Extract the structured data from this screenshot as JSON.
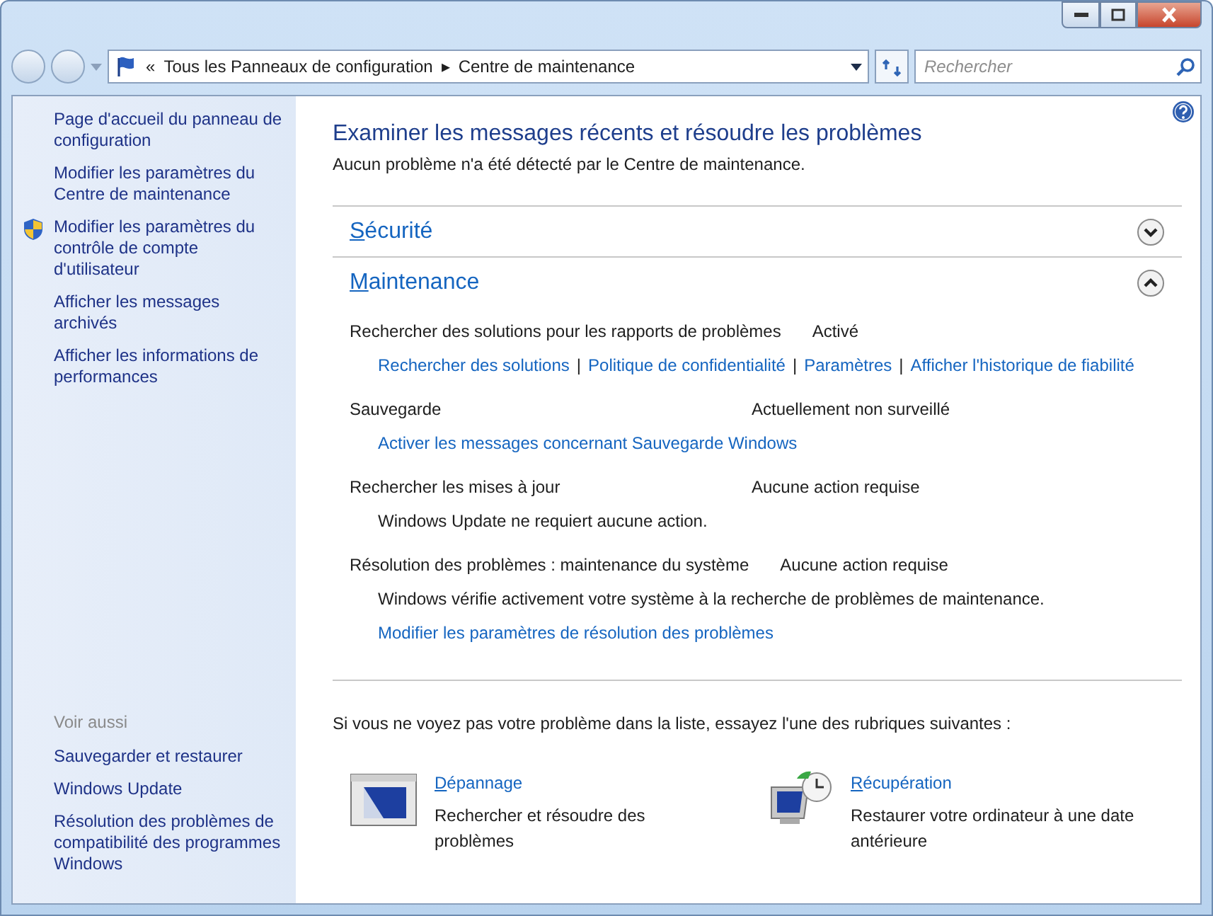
{
  "address_bar": {
    "overflow": "«",
    "separator": "▸",
    "crumbs": [
      "Tous les Panneaux de configuration",
      "Centre de maintenance"
    ]
  },
  "search": {
    "placeholder": "Rechercher"
  },
  "sidebar": {
    "links": [
      {
        "label": "Page d'accueil du panneau de configuration",
        "kind": "plain"
      },
      {
        "label": "Modifier les paramètres du Centre de maintenance",
        "kind": "plain"
      },
      {
        "label": "Modifier les paramètres du contrôle de compte d'utilisateur",
        "kind": "shield"
      },
      {
        "label": "Afficher les messages archivés",
        "kind": "plain"
      },
      {
        "label": "Afficher les informations de performances",
        "kind": "plain"
      }
    ],
    "see_also_title": "Voir aussi",
    "see_also": [
      "Sauvegarder et restaurer",
      "Windows Update",
      "Résolution des problèmes de compatibilité des programmes Windows"
    ]
  },
  "main": {
    "title": "Examiner les messages récents et résoudre les problèmes",
    "subtitle": "Aucun problème n'a été détecté par le Centre de maintenance.",
    "link_separator": "|",
    "sections": [
      {
        "heading": "Sécurité",
        "expanded": false
      },
      {
        "heading": "Maintenance",
        "expanded": true,
        "items": [
          {
            "label": "Rechercher des solutions pour les rapports de problèmes",
            "status": "Activé",
            "links": [
              "Rechercher des solutions",
              "Politique de confidentialité",
              "Paramètres",
              "Afficher l'historique de fiabilité"
            ]
          },
          {
            "label": "Sauvegarde",
            "status": "Actuellement non surveillé",
            "links": [
              "Activer les messages concernant Sauvegarde Windows"
            ]
          },
          {
            "label": "Rechercher les mises à jour",
            "status": "Aucune action requise",
            "description": "Windows Update ne requiert aucune action."
          },
          {
            "label": "Résolution des problèmes : maintenance du système",
            "status": "Aucune action requise",
            "description": "Windows vérifie activement votre système à la recherche de problèmes de maintenance.",
            "links": [
              "Modifier les paramètres de résolution des problèmes"
            ]
          }
        ]
      }
    ],
    "footer_text": "Si vous ne voyez pas votre problème dans la liste, essayez l'une des rubriques suivantes :",
    "tasks": [
      {
        "kind": "troubleshoot",
        "title": "Dépannage",
        "description": "Rechercher et résoudre des problèmes"
      },
      {
        "kind": "recovery",
        "title": "Récupération",
        "description": "Restaurer votre ordinateur à une date antérieure"
      }
    ]
  }
}
